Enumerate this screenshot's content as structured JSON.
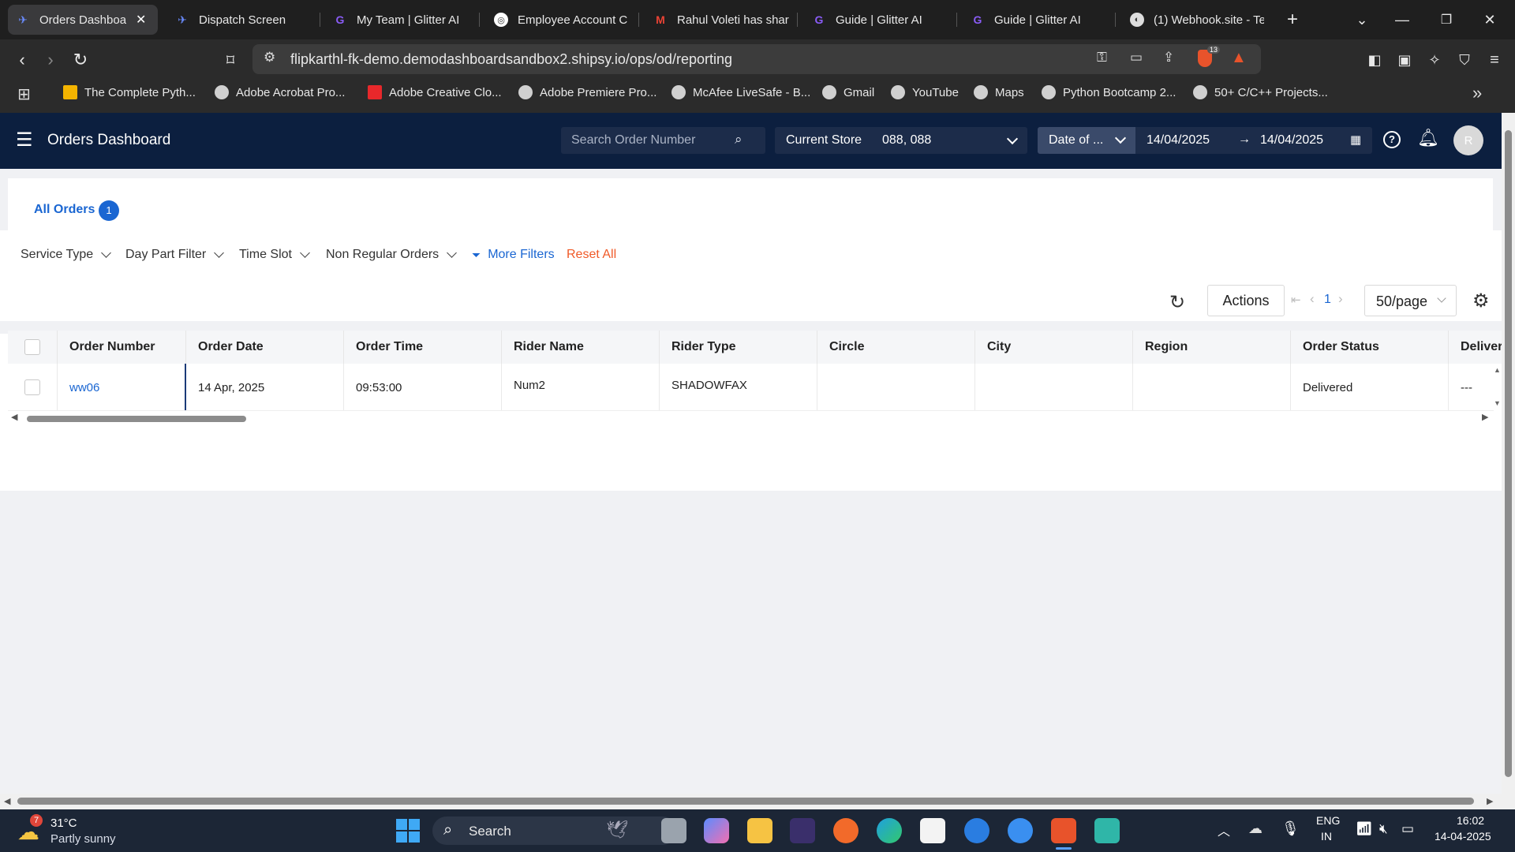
{
  "browser": {
    "tabs": [
      {
        "label": "Orders Dashboard",
        "icon": "shipsy-icon",
        "active": true
      },
      {
        "label": "Dispatch Screen",
        "icon": "shipsy-icon",
        "active": false
      },
      {
        "label": "My Team | Glitter AI",
        "icon": "glitter-icon",
        "active": false
      },
      {
        "label": "Employee Account C",
        "icon": "globe-icon",
        "active": false
      },
      {
        "label": "Rahul Voleti has shar",
        "icon": "gmail-icon",
        "active": false
      },
      {
        "label": "Guide | Glitter AI",
        "icon": "glitter-icon",
        "active": false
      },
      {
        "label": "Guide | Glitter AI",
        "icon": "glitter-icon",
        "active": false
      },
      {
        "label": "(1) Webhook.site - Te",
        "icon": "webhook-icon",
        "active": false
      }
    ],
    "url": "flipkarthl-fk-demo.demodashboardsandbox2.shipsy.io/ops/od/reporting",
    "shield_count": "13",
    "bookmarks": [
      {
        "label": "The Complete Pyth..."
      },
      {
        "label": "Adobe Acrobat Pro..."
      },
      {
        "label": "Adobe Creative Clo..."
      },
      {
        "label": "Adobe Premiere Pro..."
      },
      {
        "label": "McAfee LiveSafe - B..."
      },
      {
        "label": "Gmail"
      },
      {
        "label": "YouTube"
      },
      {
        "label": "Maps"
      },
      {
        "label": "Python Bootcamp 2..."
      },
      {
        "label": "50+ C/C++ Projects..."
      }
    ]
  },
  "header": {
    "title": "Orders Dashboard",
    "search_placeholder": "Search Order Number",
    "store_label": "Current Store",
    "store_value": "088, 088",
    "date_type": "Date of ...",
    "date_from": "14/04/2025",
    "date_to": "14/04/2025",
    "avatar_initial": "R"
  },
  "tabs": {
    "all_orders_label": "All Orders",
    "all_orders_count": "1"
  },
  "filters": {
    "service_type": "Service Type",
    "day_part": "Day Part Filter",
    "time_slot": "Time Slot",
    "non_regular": "Non Regular Orders",
    "more_filters": "More Filters",
    "reset_all": "Reset All"
  },
  "toolbar": {
    "actions_label": "Actions",
    "current_page": "1",
    "page_size": "50/page"
  },
  "table": {
    "columns": [
      "Order Number",
      "Order Date",
      "Order Time",
      "Rider Name",
      "Rider Type",
      "Circle",
      "City",
      "Region",
      "Order Status",
      "Deliver"
    ],
    "rows": [
      {
        "order_number": "ww06",
        "order_date": "14 Apr, 2025",
        "order_time": "09:53:00",
        "rider_name": "Num2",
        "rider_type": "SHADOWFAX",
        "circle": "",
        "city": "",
        "region": "",
        "order_status": "Delivered",
        "deliver": "---"
      }
    ]
  },
  "taskbar": {
    "weather_temp": "31°C",
    "weather_desc": "Partly sunny",
    "weather_badge": "7",
    "search_label": "Search",
    "lang_top": "ENG",
    "lang_bottom": "IN",
    "time": "16:02",
    "date": "14-04-2025"
  },
  "colors": {
    "header_bg": "#0c1f3f",
    "accent_blue": "#1a66d2",
    "reset_orange": "#f05a28"
  }
}
